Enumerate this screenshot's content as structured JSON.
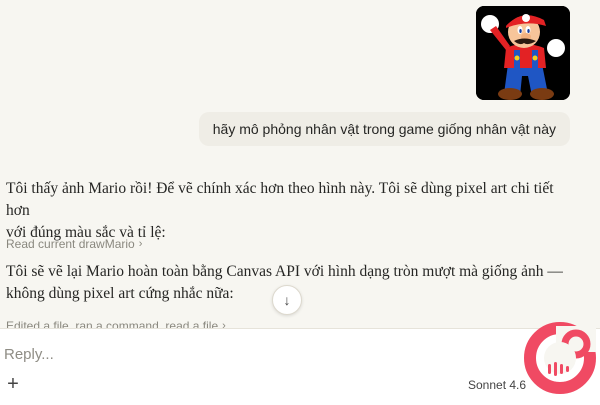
{
  "messages": {
    "user_text": "hãy mô phỏng nhân vật trong game giống nhân vật này",
    "assistant_para1_line1": "Tôi thấy ảnh Mario rồi! Để vẽ chính xác hơn theo hình này. Tôi sẽ dùng pixel art chi tiết hơn",
    "assistant_para1_line2": "với đúng màu sắc và tỉ lệ:",
    "tool1_label": "Read current drawMario",
    "assistant_para2_line1": "Tôi sẽ vẽ lại Mario hoàn toàn bằng Canvas API với hình dạng tròn mượt mà giống ảnh —",
    "assistant_para2_line2": "không dùng pixel art cứng nhắc nữa:",
    "tool2_label": "Edited a file, ran a command, read a file"
  },
  "composer": {
    "placeholder": "Reply...",
    "model_label": "Sonnet 4.6"
  },
  "icons": {
    "attachment": "plus-icon",
    "scroll": "arrow-down-icon",
    "chevron": "chevron-right-icon"
  },
  "colors": {
    "background": "#f7f6f1",
    "user_bubble": "#efede6",
    "brand_pink": "#f04a63"
  }
}
